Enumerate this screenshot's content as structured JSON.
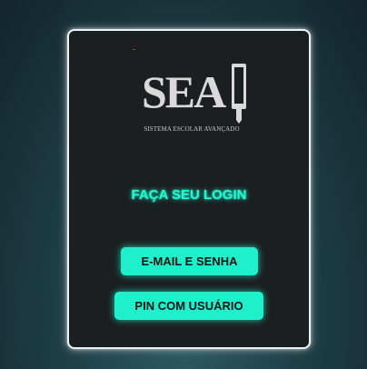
{
  "logo": {
    "word": "SEA",
    "subtitle": "SISTEMA ESCOLAR AVANÇADO",
    "icon": "pencil-tablet-icon"
  },
  "login": {
    "title": "FAÇA SEU LOGIN",
    "email_button": "E-MAIL E SENHA",
    "pin_button": "PIN COM USUÁRIO"
  },
  "colors": {
    "accent": "#1ff0cc",
    "title": "#25f5d0",
    "card_bg": "#1b1f20",
    "card_border": "#e9f2f2"
  }
}
